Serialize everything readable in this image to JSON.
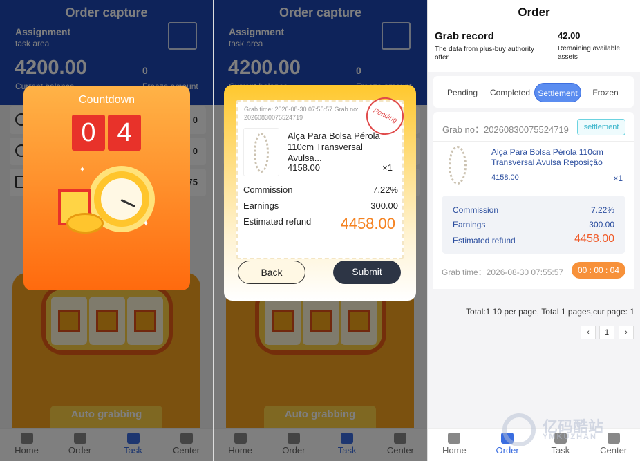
{
  "task_screen": {
    "title": "Order capture",
    "assignment": "Assignment",
    "task_area": "task area",
    "amount": "4200.00",
    "count": "0",
    "sub_left": "Current balance",
    "sub_right": "Freeze amount",
    "row_values": [
      "0",
      "0",
      "75"
    ],
    "auto_button": "Auto grabbing"
  },
  "tabbar_left": [
    "Home",
    "Order",
    "Task",
    "Center"
  ],
  "countdown": {
    "title": "Countdown",
    "digits": [
      "0",
      "4"
    ]
  },
  "order_popup": {
    "grab_time": "Grab time:  2026-08-30 07:55:57 Grab no:  20260830075524719",
    "stamp": "Pending",
    "product_name": "Alça Para Bolsa Pérola 110cm Transversal Avulsa...",
    "price": "4158.00",
    "qty": "×1",
    "commission_label": "Commission",
    "commission_value": "7.22%",
    "earnings_label": "Earnings",
    "earnings_value": "300.00",
    "refund_label": "Estimated refund",
    "refund_value": "4458.00",
    "back": "Back",
    "submit": "Submit"
  },
  "order_page": {
    "title": "Order",
    "grab_record": "Grab record",
    "grab_record_sub": "The data from plus-buy authority offer",
    "assets_value": "42.00",
    "assets_label": "Remaining available assets",
    "tabs": [
      "Pending",
      "Completed",
      "Settlement",
      "Frozen"
    ],
    "active_tab": "Settlement",
    "grab_no": "Grab no：20260830075524719",
    "status": "settlement",
    "product_name": "Alça Para Bolsa Pérola 110cm Transversal Avulsa Reposição",
    "price": "4158.00",
    "qty": "×1",
    "commission_label": "Commission",
    "commission_value": "7.22%",
    "earnings_label": "Earnings",
    "earnings_value": "300.00",
    "refund_label": "Estimated refund",
    "refund_value": "4458.00",
    "grab_time": "Grab time：2026-08-30 07:55:57",
    "timer": "00 : 00 : 04",
    "pagination_text": "Total:1 10 per page, Total 1 pages,cur page: 1",
    "prev": "‹",
    "page": "1",
    "next": "›",
    "tabbar": [
      "Home",
      "Order",
      "Task",
      "Center"
    ],
    "watermark": "亿码酷站",
    "watermark_sub": "YMKUZHAN"
  },
  "colors": {
    "header_blue": "#1d46b4",
    "accent_blue": "#3a6de0",
    "orange": "#f58220",
    "countdown_red": "#e8322a"
  }
}
